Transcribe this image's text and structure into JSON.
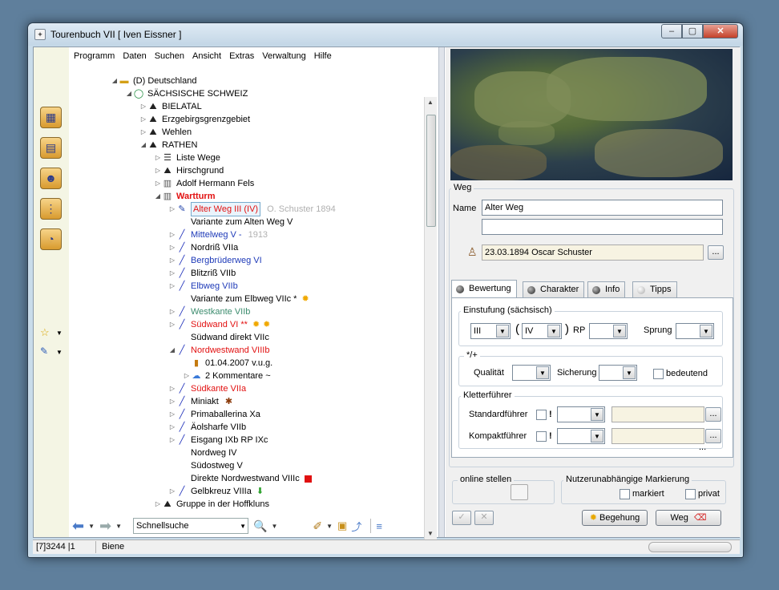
{
  "window": {
    "title": "Tourenbuch VII   [ Iven  Eissner ]"
  },
  "menu": [
    "Programm",
    "Daten",
    "Suchen",
    "Ansicht",
    "Extras",
    "Verwaltung",
    "Hilfe"
  ],
  "left_strip_icons": [
    "map-icon",
    "calendar-icon",
    "people-icon",
    "route-icon",
    "chart-icon"
  ],
  "tree": [
    {
      "label": "(D)  Deutschland",
      "level": 0,
      "icon": "flag-icon",
      "exp": "◢"
    },
    {
      "label": "SÄCHSISCHE SCHWEIZ",
      "level": 1,
      "icon": "ring-icon",
      "exp": "◢"
    },
    {
      "label": "BIELATAL",
      "level": 2,
      "icon": "mountain-icon",
      "exp": "▷"
    },
    {
      "label": "Erzgebirgsgrenzgebiet",
      "level": 2,
      "icon": "mountain-icon",
      "exp": "▷"
    },
    {
      "label": "Wehlen",
      "level": 2,
      "icon": "mountain-icon",
      "exp": "▷"
    },
    {
      "label": "RATHEN",
      "level": 2,
      "icon": "mountain-icon",
      "exp": "◢"
    },
    {
      "label": "Liste Wege",
      "level": 3,
      "icon": "list-icon",
      "exp": "▷"
    },
    {
      "label": "Hirschgrund",
      "level": 3,
      "icon": "mountain-icon",
      "exp": "▷"
    },
    {
      "label": "Adolf Hermann Fels",
      "level": 3,
      "icon": "rock-icon",
      "exp": "▷"
    },
    {
      "label": "Wartturm",
      "level": 3,
      "icon": "rock-icon",
      "exp": "◢",
      "cls": "red bold"
    },
    {
      "label": "Alter Weg III (IV)",
      "level": 4,
      "icon": "pencil-icon",
      "exp": "▷",
      "cls": "red",
      "extra": "O. Schuster 1894",
      "selected": true
    },
    {
      "label": "Variante zum Alten Weg V",
      "level": 4,
      "icon": "",
      "exp": ""
    },
    {
      "label": "Mittelweg V -",
      "level": 4,
      "icon": "route-line-icon",
      "exp": "▷",
      "cls": "blue",
      "extra": "1913"
    },
    {
      "label": "Nordriß VIIa",
      "level": 4,
      "icon": "route-line-icon",
      "exp": "▷"
    },
    {
      "label": "Bergbrüderweg VI",
      "level": 4,
      "icon": "route-line-icon",
      "exp": "▷",
      "cls": "blue"
    },
    {
      "label": "Blitzriß VIIb",
      "level": 4,
      "icon": "route-line-icon",
      "exp": "▷"
    },
    {
      "label": "Elbweg VIIb",
      "level": 4,
      "icon": "route-line-icon",
      "exp": "▷",
      "cls": "blue"
    },
    {
      "label": "Variante zum Elbweg VIIc *",
      "level": 4,
      "icon": "",
      "exp": "",
      "sun": true
    },
    {
      "label": "Westkante VIIb",
      "level": 4,
      "icon": "route-line-icon",
      "exp": "▷",
      "cls": "green"
    },
    {
      "label": "Südwand VI **",
      "level": 4,
      "icon": "route-line-icon",
      "exp": "▷",
      "cls": "red",
      "sun": true,
      "sun2": true
    },
    {
      "label": "Südwand direkt VIIc",
      "level": 4,
      "icon": "",
      "exp": ""
    },
    {
      "label": "Nordwestwand VIIIb",
      "level": 4,
      "icon": "route-line-icon",
      "exp": "◢",
      "cls": "red"
    },
    {
      "label": "01.04.2007 v.u.g.",
      "level": 5,
      "icon": "bottle-icon",
      "exp": ""
    },
    {
      "label": "2 Kommentare ~",
      "level": 5,
      "icon": "comment-icon",
      "exp": "▷"
    },
    {
      "label": "Südkante VIIa",
      "level": 4,
      "icon": "route-line-icon",
      "exp": "▷",
      "cls": "red"
    },
    {
      "label": "Miniakt",
      "level": 4,
      "icon": "route-line-icon",
      "exp": "▷",
      "bug": true
    },
    {
      "label": "Primaballerina Xa",
      "level": 4,
      "icon": "route-line-icon",
      "exp": "▷"
    },
    {
      "label": "Äolsharfe VIIb",
      "level": 4,
      "icon": "route-line-icon",
      "exp": "▷"
    },
    {
      "label": "Eisgang IXb RP IXc",
      "level": 4,
      "icon": "route-line-icon",
      "exp": "▷"
    },
    {
      "label": "Nordweg IV",
      "level": 4,
      "icon": "",
      "exp": ""
    },
    {
      "label": "Südostweg V",
      "level": 4,
      "icon": "",
      "exp": ""
    },
    {
      "label": "Direkte Nordwestwand VIIIc",
      "level": 4,
      "icon": "",
      "exp": "",
      "redsq": true
    },
    {
      "label": "Gelbkreuz VIIIa",
      "level": 4,
      "icon": "route-line-icon",
      "exp": "▷",
      "arrow": true
    },
    {
      "label": "Gruppe in der Hoffkluns",
      "level": 3,
      "icon": "mountain-icon",
      "exp": "▷"
    }
  ],
  "toolbar": {
    "quicksearch": "Schnellsuche"
  },
  "weg": {
    "group_label": "Weg",
    "name_label": "Name",
    "name_value": "Alter Weg",
    "name2_value": "",
    "first_ascent": "23.03.1894 Oscar Schuster",
    "browse_label": "..."
  },
  "tabs": [
    "Bewertung",
    "Charakter",
    "Info",
    "Tipps"
  ],
  "einstufung": {
    "label": "Einstufung (sächsisch)",
    "grade": "III",
    "open_paren": "(",
    "grade2": "IV",
    "close_paren": ")",
    "rp_label": "RP",
    "rp": "",
    "sprung_label": "Sprung",
    "sprung": ""
  },
  "quality": {
    "label": "*/+",
    "qualitaet_label": "Qualität",
    "sicherung_label": "Sicherung",
    "bedeutend_label": "bedeutend"
  },
  "kletterfuehrer": {
    "label": "Kletterführer",
    "standard_label": "Standardführer",
    "kompakt_label": "Kompaktführer",
    "excl": "!",
    "ellipsis": "..."
  },
  "more": "...",
  "online": {
    "label": "online stellen"
  },
  "marking": {
    "label": "Nutzerunabhängige Markierung",
    "markiert": "markiert",
    "privat": "privat"
  },
  "buttons": {
    "begehung": "Begehung",
    "weg": "Weg"
  },
  "status": {
    "left": "[7]3244  |1",
    "right": "Biene"
  }
}
